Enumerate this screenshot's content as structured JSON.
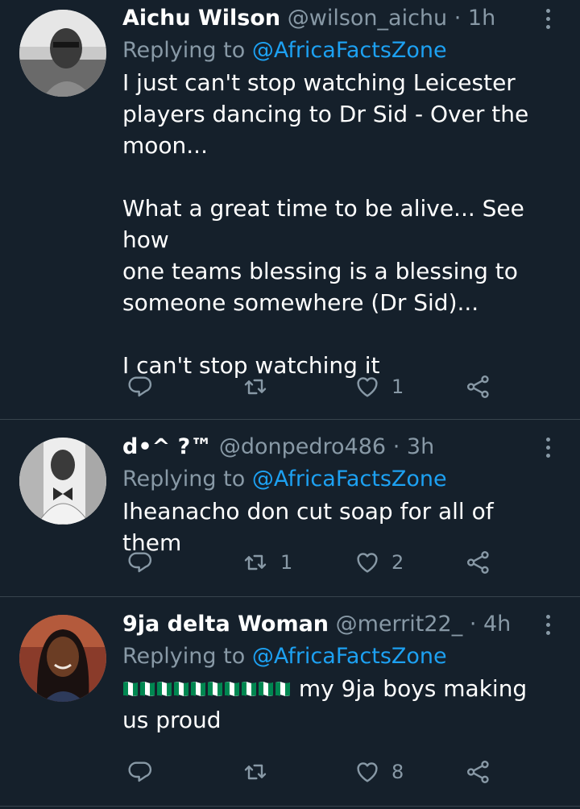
{
  "colors": {
    "background": "#15202b",
    "divider": "#38444d",
    "primary_text": "#ffffff",
    "secondary_text": "#8899a6",
    "accent": "#1da1f2"
  },
  "icons": [
    "reply-icon",
    "retweet-icon",
    "like-icon",
    "share-icon",
    "more-options-icon",
    "nigeria-flag-icon"
  ],
  "tweets": [
    {
      "name": "Aichu Wilson",
      "handle": "@wilson_aichu",
      "dot": "·",
      "time": "1h",
      "replying_prefix": "Replying to",
      "replying_to": "@AfricaFactsZone",
      "text": "I just can't stop watching Leicester\nplayers dancing to Dr Sid - Over the\nmoon...\n\nWhat a great time to be alive... See how\none teams blessing is a blessing to\nsomeone somewhere (Dr Sid)...\n\nI can't stop watching it",
      "reply_count": "",
      "retweet_count": "",
      "like_count": "1"
    },
    {
      "name": "d•^ ?™",
      "handle": "@donpedro486",
      "dot": "·",
      "time": "3h",
      "replying_prefix": "Replying to",
      "replying_to": "@AfricaFactsZone",
      "text": "Iheanacho don cut soap for all of them",
      "reply_count": "",
      "retweet_count": "1",
      "like_count": "2"
    },
    {
      "name": "9ja delta Woman",
      "handle": "@merrit22_",
      "dot": "·",
      "time": "4h",
      "replying_prefix": "Replying to",
      "replying_to": "@AfricaFactsZone",
      "flag_emoji_count": 10,
      "text_after_flags": " my 9ja boys making",
      "text_line2": "us proud",
      "reply_count": "",
      "retweet_count": "",
      "like_count": "8"
    }
  ]
}
